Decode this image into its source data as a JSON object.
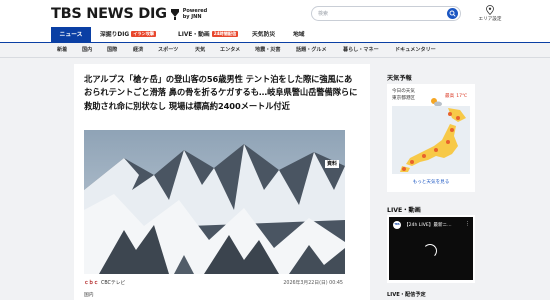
{
  "header": {
    "logo_text": "TBS NEWS DIG",
    "powered_line1": "Powered",
    "powered_line2": "by JNN",
    "search_placeholder": "検索",
    "area_label": "エリア設定"
  },
  "global_nav": {
    "items": [
      {
        "label": "ニュース",
        "active": true
      },
      {
        "label": "深掘りDIG",
        "badge": "イラン攻撃"
      },
      {
        "label": "LIVE・動画",
        "badge": "24時間配信"
      },
      {
        "label": "天気防災"
      },
      {
        "label": "地域"
      }
    ]
  },
  "sub_nav": {
    "items": [
      "新着",
      "国内",
      "国際",
      "経済",
      "スポーツ",
      "天気",
      "エンタメ",
      "地震・災害",
      "話題・グルメ",
      "暮らし・マネー",
      "ドキュメンタリー"
    ]
  },
  "article": {
    "headline": "北アルプス「槍ヶ岳」の登山客の56歳男性 テント泊をした際に強風にあおられテントごと滑落 鼻の骨を折るケガするも…岐阜県警山岳警備隊らに救助され命に別状なし 現場は標高約2400メートル付近",
    "image_tag": "資料",
    "source_icon": "ｃｂｃ",
    "source_name": "CBCテレビ",
    "timestamp": "2026年3月22日(日) 00:45",
    "category": "国内"
  },
  "sidebar": {
    "weather": {
      "title": "天気予報",
      "label_line1": "今日の天気",
      "label_line2": "東京都港区",
      "high_label": "最高",
      "high_value": "17℃",
      "more_link": "もっと天気を見る"
    },
    "live": {
      "title": "LIVE・動画",
      "video_title": "【24h LIVE】最新ニ...",
      "video_logo": "TBS",
      "menu_icon": "⋮",
      "list_title": "LIVE・配信予定"
    }
  },
  "colors": {
    "brand_blue": "#0a3fa4",
    "badge_red": "#e8472d",
    "link_blue": "#1b56c2",
    "high_temp_red": "#d9341f"
  }
}
